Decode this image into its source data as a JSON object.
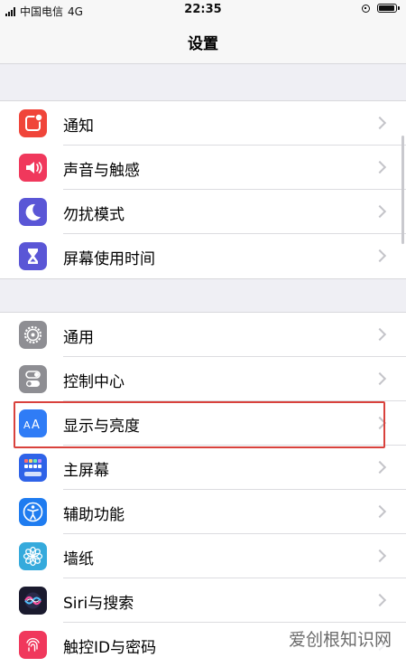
{
  "status_bar": {
    "carrier": "中国电信",
    "network": "4G",
    "time": "22:35"
  },
  "nav": {
    "title": "设置"
  },
  "groups": [
    {
      "items": [
        {
          "label": "通知",
          "icon": "notifications-icon",
          "color": "#f0453a"
        },
        {
          "label": "声音与触感",
          "icon": "sounds-icon",
          "color": "#f0385c"
        },
        {
          "label": "勿扰模式",
          "icon": "moon-icon",
          "color": "#5a56d6"
        },
        {
          "label": "屏幕使用时间",
          "icon": "hourglass-icon",
          "color": "#5a56d6"
        }
      ]
    },
    {
      "items": [
        {
          "label": "通用",
          "icon": "gear-icon",
          "color": "#8e8e93"
        },
        {
          "label": "控制中心",
          "icon": "toggles-icon",
          "color": "#8e8e93"
        },
        {
          "label": "显示与亮度",
          "icon": "text-size-icon",
          "color": "#2f7cf6"
        },
        {
          "label": "主屏幕",
          "icon": "home-screen-icon",
          "color": "#2f63e8"
        },
        {
          "label": "辅助功能",
          "icon": "accessibility-icon",
          "color": "#1f7cf0"
        },
        {
          "label": "墙纸",
          "icon": "flower-icon",
          "color": "#35aadc"
        },
        {
          "label": "Siri与搜索",
          "icon": "siri-icon",
          "color": "#1a1a2e"
        },
        {
          "label": "触控ID与密码",
          "icon": "fingerprint-icon",
          "color": "#f0385c"
        }
      ]
    }
  ],
  "highlighted_item": "显示与亮度",
  "watermark": "爱创根知识网"
}
